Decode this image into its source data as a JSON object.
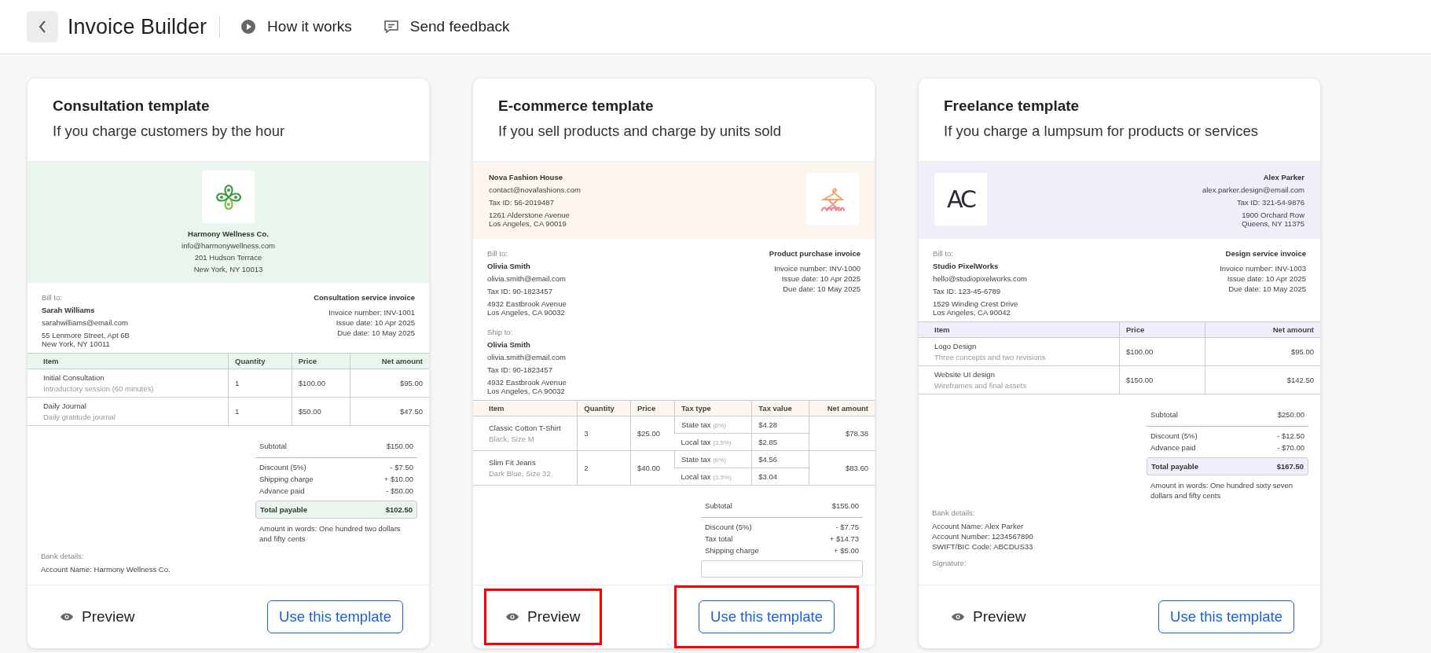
{
  "header": {
    "title": "Invoice Builder",
    "links": [
      {
        "kind": "play",
        "label": "How it works"
      },
      {
        "kind": "chat",
        "label": "Send feedback"
      }
    ]
  },
  "templates": [
    {
      "title": "Consultation template",
      "subtitle": "If you charge customers by the hour",
      "color": "#e8f6ee",
      "kind": "centered",
      "logo": {
        "kind": "clover"
      },
      "sender": {
        "name": "Harmony Wellness Co.",
        "lines": [
          "info@harmonywellness.com"
        ],
        "address": [
          "201 Hudson Terrace",
          "New York, NY 10013"
        ]
      },
      "bill_to": {
        "label": "Bill to:",
        "name": "Sarah Williams",
        "lines": [
          "sarahwilliams@email.com"
        ],
        "address": [
          "55 Lenmore Street, Apt 6B",
          "New York, NY 10011"
        ]
      },
      "invoice": {
        "title": "Consultation service invoice",
        "lines": [
          "Invoice number: INV-1001",
          "Issue date: 10 Apr 2025",
          "Due date: 10 May 2025"
        ]
      },
      "table": {
        "columns": [
          "Item",
          "Quantity",
          "Price",
          "Net amount"
        ],
        "rows": [
          {
            "item": "Initial Consultation",
            "description": "Introductory session (60 minutes)",
            "quantity": "1",
            "price": "$100.00",
            "net_amount": "$95.00"
          },
          {
            "item": "Daily Journal",
            "description": "Daily gratitude journal",
            "quantity": "1",
            "price": "$50.00",
            "net_amount": "$47.50"
          }
        ]
      },
      "totals": {
        "subtotal": {
          "label": "Subtotal",
          "value": "$150.00"
        },
        "adjustments": [
          {
            "label": "Discount (5%)",
            "value": "- $7.50"
          },
          {
            "label": "Shipping charge",
            "value": "+ $10.00"
          },
          {
            "label": "Advance paid",
            "value": "- $50.00"
          }
        ],
        "total": {
          "label": "Total payable",
          "value": "$102.50"
        },
        "amount_in_words": "Amount in words: One hundred two dollars and fifty cents"
      },
      "bank": {
        "label": "Bank details:",
        "lines": [
          "Account Name: Harmony Wellness Co."
        ]
      },
      "actions": {
        "preview": {
          "label": "Preview",
          "highlighted": false
        },
        "use": {
          "label": "Use this template",
          "highlighted": false
        }
      }
    },
    {
      "title": "E-commerce template",
      "subtitle": "If you sell products and charge by units sold",
      "color": "#fdf6ec",
      "kind": "logo-right",
      "logo": {
        "kind": "hanger"
      },
      "sender": {
        "name": "Nova Fashion House",
        "lines": [
          "contact@novafashions.com",
          "Tax ID: 56-2019487"
        ],
        "address": [
          "1261 Alderstone Avenue",
          "Los Angeles, CA 90019"
        ]
      },
      "bill_to": {
        "label": "Bill to:",
        "name": "Olivia Smith",
        "lines": [
          "olivia.smith@email.com",
          "Tax ID: 90-1823457"
        ],
        "address": [
          "4932 Eastbrook Avenue",
          "Los Angeles, CA 90032"
        ]
      },
      "ship_to": {
        "label": "Ship to:",
        "name": "Olivia Smith",
        "lines": [
          "olivia.smith@email.com",
          "Tax ID: 90-1823457"
        ],
        "address": [
          "4932 Eastbrook Avenue",
          "Los Angeles, CA 90032"
        ]
      },
      "invoice": {
        "title": "Product purchase invoice",
        "lines": [
          "Invoice number: INV-1000",
          "Issue date: 10 Apr 2025",
          "Due date: 10 May 2025"
        ]
      },
      "table": {
        "columns": [
          "Item",
          "Quantity",
          "Price",
          "Tax type",
          "Tax value",
          "Net amount"
        ],
        "rows": [
          {
            "item": "Classic Cotton T-Shirt",
            "description": "Black, Size M",
            "quantity": "3",
            "price": "$25.00",
            "taxes": [
              {
                "type": "State tax",
                "rate": "(6%)",
                "value": "$4.28"
              },
              {
                "type": "Local tax",
                "rate": "(3.5%)",
                "value": "$2.85"
              }
            ],
            "net_amount": "$78.38"
          },
          {
            "item": "Slim Fit Jeans",
            "description": "Dark Blue, Size 32",
            "quantity": "2",
            "price": "$40.00",
            "taxes": [
              {
                "type": "State tax",
                "rate": "(6%)",
                "value": "$4.56"
              },
              {
                "type": "Local tax",
                "rate": "(3.5%)",
                "value": "$3.04"
              }
            ],
            "net_amount": "$83.60"
          }
        ]
      },
      "totals": {
        "subtotal": {
          "label": "Subtotal",
          "value": "$155.00"
        },
        "adjustments": [
          {
            "label": "Discount (5%)",
            "value": "- $7.75"
          },
          {
            "label": "Tax total",
            "value": "+ $14.73"
          },
          {
            "label": "Shipping charge",
            "value": "+ $5.00"
          }
        ]
      },
      "actions": {
        "preview": {
          "label": "Preview",
          "highlighted": true
        },
        "use": {
          "label": "Use this template",
          "highlighted": true
        }
      }
    },
    {
      "title": "Freelance template",
      "subtitle": "If you charge a lumpsum for products or services",
      "color": "#f1edfb",
      "kind": "logo-left",
      "logo": {
        "kind": "monogram",
        "text": "AC"
      },
      "sender": {
        "name": "Alex Parker",
        "lines": [
          "alex.parker.design@email.com",
          "Tax ID: 321-54-9876"
        ],
        "address": [
          "1900 Orchard Row",
          "Queens, NY 11375"
        ]
      },
      "bill_to": {
        "label": "Bill to:",
        "name": "Studio PixelWorks",
        "lines": [
          "hello@studiopixelworks.com",
          "Tax ID: 123-45-6789"
        ],
        "address": [
          "1529 Winding Crest Drive",
          "Los Angeles, CA 90042"
        ]
      },
      "invoice": {
        "title": "Design service invoice",
        "lines": [
          "Invoice number: INV-1003",
          "Issue date: 10 Apr 2025",
          "Due date: 10 May 2025"
        ]
      },
      "table": {
        "columns": [
          "Item",
          "Price",
          "Net amount"
        ],
        "rows": [
          {
            "item": "Logo Design",
            "description": "Three concepts and two revisions",
            "price": "$100.00",
            "net_amount": "$95.00"
          },
          {
            "item": "Website UI design",
            "description": "Wireframes and final assets",
            "price": "$150.00",
            "net_amount": "$142.50"
          }
        ]
      },
      "totals": {
        "subtotal": {
          "label": "Subtotal",
          "value": "$250.00"
        },
        "adjustments": [
          {
            "label": "Discount (5%)",
            "value": "- $12.50"
          },
          {
            "label": "Advance paid",
            "value": "- $70.00"
          }
        ],
        "total": {
          "label": "Total payable",
          "value": "$167.50"
        },
        "amount_in_words": "Amount in words: One hundred sixty seven dollars and fifty cents"
      },
      "bank": {
        "label": "Bank details:",
        "lines": [
          "Account Name: Alex Parker",
          "Account Number: 1234567890",
          "SWIFT/BIC Code: ABCDUS33"
        ]
      },
      "signature": {
        "label": "Signature:"
      },
      "actions": {
        "preview": {
          "label": "Preview",
          "highlighted": false
        },
        "use": {
          "label": "Use this template",
          "highlighted": false
        }
      }
    }
  ]
}
